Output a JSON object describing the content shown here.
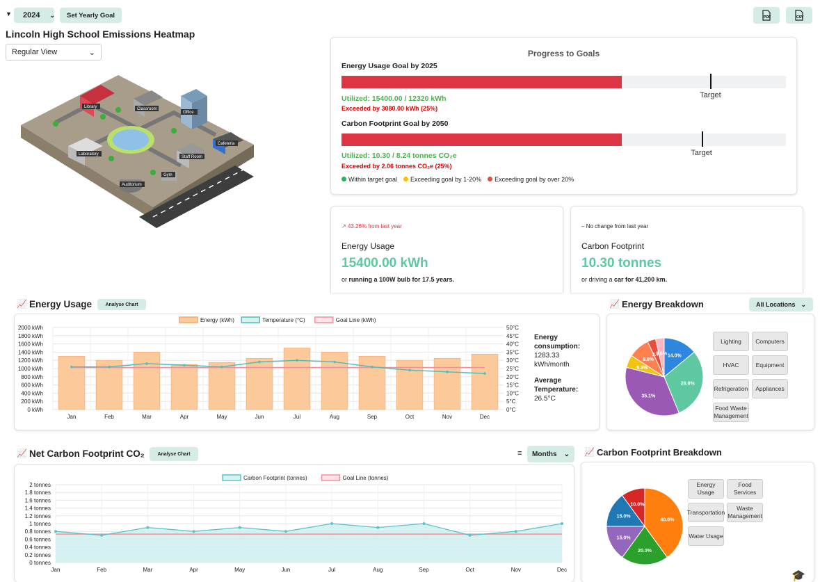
{
  "toolbar": {
    "year": "2024",
    "set_goal": "Set Yearly Goal",
    "pdf": "PDF",
    "csv": "CSV"
  },
  "heatmap": {
    "title": "Lincoln High School Emissions Heatmap",
    "view": "Regular View",
    "buildings": [
      "Library",
      "Classroom",
      "Office",
      "Laboratory",
      "Cafeteria",
      "Staff Room",
      "Gym",
      "Auditorium"
    ]
  },
  "progress": {
    "title": "Progress to Goals",
    "goals": [
      {
        "title": "Energy Usage Goal by 2025",
        "fill_pct": 63,
        "target_pct": 83,
        "target_label": "Target",
        "utilized": "Utilized: 15400.00 / 12320 kWh",
        "exceeded": "Exceeded by 3080.00 kWh (25%)"
      },
      {
        "title": "Carbon Footprint Goal by 2050",
        "fill_pct": 63,
        "target_pct": 81,
        "target_label": "Target",
        "utilized": "Utilized: 10.30 / 8.24 tonnes CO₂e",
        "exceeded": "Exceeded by 2.06 tonnes CO₂e (25%)"
      }
    ],
    "legend": [
      {
        "label": "Within target goal",
        "color": "#28b463"
      },
      {
        "label": "Exceeding goal by 1-20%",
        "color": "#f1c40f"
      },
      {
        "label": "Exceeding goal by over 20%",
        "color": "#e74c3c"
      }
    ]
  },
  "stats": [
    {
      "change": "43.26% from last year",
      "change_color": "#dc3545",
      "change_icon": "↗",
      "title": "Energy Usage",
      "value": "15400.00 kWh",
      "note_pre": "or ",
      "note_bold": "running a 100W bulb for 17.5 years."
    },
    {
      "change": "No change from last year",
      "change_color": "#222",
      "change_icon": "–",
      "title": "Carbon Footprint",
      "value": "10.30 tonnes",
      "note_pre": "or driving a ",
      "note_bold": "car for 41,200 km."
    }
  ],
  "energy_chart": {
    "title": "Energy Usage",
    "analyse": "Analyse Chart",
    "summary": {
      "consumption_label": "Energy consumption:",
      "consumption_value": "1283.33 kWh/month",
      "temp_label": "Average Temperature:",
      "temp_value": "26.5°C"
    }
  },
  "energy_breakdown": {
    "title": "Energy Breakdown",
    "filter": "All Locations",
    "tags": [
      "Lighting",
      "Computers",
      "HVAC",
      "Equipment",
      "Refrigeration",
      "Appliances",
      "Food Waste Management"
    ]
  },
  "carbon_chart": {
    "title": "Net Carbon Footprint CO₂",
    "analyse": "Analyse Chart",
    "period": "Months"
  },
  "carbon_breakdown": {
    "title": "Carbon Footprint Breakdown",
    "tags": [
      "Energy Usage",
      "Food Services",
      "Transportation",
      "Waste Management",
      "Water Usage"
    ]
  },
  "chart_data": [
    {
      "type": "bar",
      "categories": [
        "Jan",
        "Feb",
        "Mar",
        "Apr",
        "May",
        "Jun",
        "Jul",
        "Aug",
        "Sep",
        "Oct",
        "Nov",
        "Dec"
      ],
      "series": [
        {
          "name": "Energy (kWh)",
          "type": "bar",
          "axis": "left",
          "values": [
            1300,
            1200,
            1400,
            1100,
            1150,
            1250,
            1500,
            1400,
            1300,
            1200,
            1250,
            1350
          ],
          "color": "#fbc99a"
        },
        {
          "name": "Temperature (°C)",
          "type": "line",
          "axis": "right",
          "values": [
            26,
            26,
            28,
            27,
            26,
            29,
            30,
            29,
            26,
            24,
            23,
            22
          ],
          "color": "#4fbfb8"
        },
        {
          "name": "Goal Line (kWh)",
          "type": "line",
          "axis": "left",
          "values": [
            1026,
            1026,
            1026,
            1026,
            1026,
            1026,
            1026,
            1026,
            1026,
            1026,
            1026,
            1026
          ],
          "color": "#f0909e"
        }
      ],
      "yticks_left": [
        "0 kWh",
        "200 kWh",
        "400 kWh",
        "600 kWh",
        "800 kWh",
        "1000 kWh",
        "1200 kWh",
        "1400 kWh",
        "1600 kWh",
        "1800 kWh",
        "2000 kWh"
      ],
      "yticks_right": [
        "0°C",
        "5°C",
        "10°C",
        "15°C",
        "20°C",
        "25°C",
        "30°C",
        "35°C",
        "40°C",
        "45°C",
        "50°C"
      ],
      "ylim": [
        0,
        2000
      ],
      "ylim_right": [
        0,
        50
      ],
      "grid": true,
      "legend": "top"
    },
    {
      "type": "pie",
      "labels": [
        "Lighting",
        "Computers",
        "HVAC",
        "Equipment",
        "Refrigeration",
        "Appliances",
        "Food Waste Management"
      ],
      "values": [
        14.0,
        29.8,
        35.1,
        5.3,
        8.8,
        3.4,
        3.6
      ],
      "display": [
        "14.0%",
        "29.8%",
        "35.1%",
        "5.3%",
        "8.8%",
        "3.%",
        "3.6%"
      ],
      "colors": [
        "#2e86de",
        "#5ec8a0",
        "#9b59b6",
        "#f1c40f",
        "#ff7f50",
        "#e74c3c",
        "#ffb6c1"
      ]
    },
    {
      "type": "area",
      "categories": [
        "Jan",
        "Feb",
        "Mar",
        "Apr",
        "May",
        "Jun",
        "Jul",
        "Aug",
        "Sep",
        "Oct",
        "Nov",
        "Dec"
      ],
      "series": [
        {
          "name": "Carbon Footprint (tonnes)",
          "values": [
            0.8,
            0.7,
            0.9,
            0.8,
            0.9,
            0.8,
            1.0,
            0.9,
            1.0,
            0.7,
            0.8,
            1.0
          ],
          "color": "#56c4c8"
        },
        {
          "name": "Goal Line (tonnes)",
          "values": [
            0.73,
            0.73,
            0.73,
            0.73,
            0.73,
            0.73,
            0.73,
            0.73,
            0.73,
            0.73,
            0.73,
            0.73
          ],
          "color": "#f0909e"
        }
      ],
      "yticks": [
        "0 tonnes",
        "0.2 tonnes",
        "0.4 tonnes",
        "0.6 tonnes",
        "0.8 tonnes",
        "1 tonnes",
        "1.2 tonnes",
        "1.4 tonnes",
        "1.6 tonnes",
        "1.8 tonnes",
        "2 tonnes"
      ],
      "ylim": [
        0,
        2
      ],
      "grid": true,
      "legend": "top"
    },
    {
      "type": "pie",
      "labels": [
        "Energy Usage",
        "Food Services",
        "Transportation",
        "Waste Management",
        "Water Usage"
      ],
      "values": [
        40.0,
        20.0,
        15.0,
        15.0,
        10.0
      ],
      "display": [
        "40.0%",
        "20.0%",
        "15.0%",
        "15.0%",
        "10.0%"
      ],
      "colors": [
        "#ff7f0e",
        "#2ca02c",
        "#9467bd",
        "#1f77b4",
        "#d62728"
      ]
    }
  ]
}
